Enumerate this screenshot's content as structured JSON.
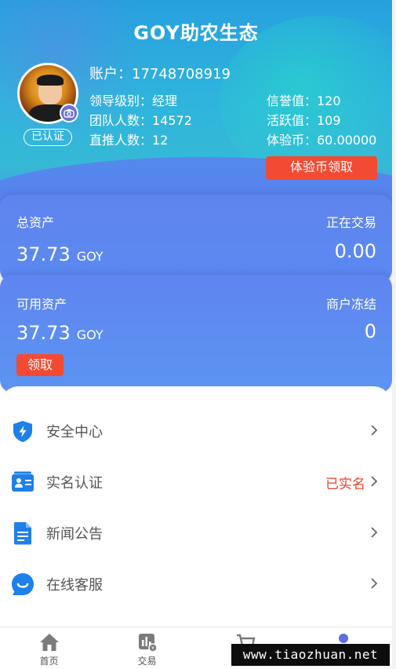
{
  "header": {
    "title": "GOY助农生态",
    "account": "账户：17748708919",
    "verified_badge": "已认证",
    "info_left": [
      "领导级别：经理",
      "团队人数：14572",
      "直推人数：12"
    ],
    "info_right": [
      "信誉值：120",
      "活跃值：109",
      "体验币：60.00000"
    ],
    "claim_trial_button": "体验币领取"
  },
  "assets": {
    "total_label": "总资产",
    "total_value": "37.73",
    "total_unit": "GOY",
    "trading_label": "正在交易",
    "trading_value": "0.00",
    "available_label": "可用资产",
    "available_value": "37.73",
    "available_unit": "GOY",
    "frozen_label": "商户冻结",
    "frozen_value": "0",
    "claim_button": "领取"
  },
  "menu": [
    {
      "label": "安全中心",
      "status": "",
      "icon": "shield-lightning-icon"
    },
    {
      "label": "实名认证",
      "status": "已实名",
      "icon": "id-card-icon"
    },
    {
      "label": "新闻公告",
      "status": "",
      "icon": "document-icon"
    },
    {
      "label": "在线客服",
      "status": "",
      "icon": "chat-bubble-icon"
    }
  ],
  "tabbar": [
    {
      "label": "首页",
      "icon": "home-icon"
    },
    {
      "label": "交易",
      "icon": "trade-icon"
    },
    {
      "label": "",
      "icon": "cart-icon"
    },
    {
      "label": "",
      "icon": "user-icon"
    }
  ],
  "watermark": "www.tiaozhuan.net",
  "colors": {
    "accent_red": "#f24a33",
    "card_blue": "#5c8af0",
    "icon_blue": "#1e80e8"
  }
}
